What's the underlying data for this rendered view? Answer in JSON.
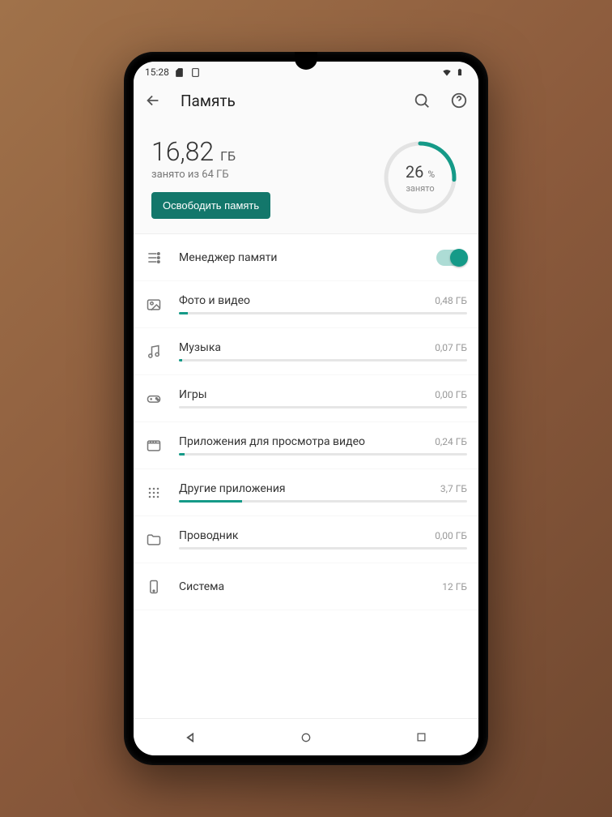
{
  "status": {
    "time": "15:28"
  },
  "header": {
    "title": "Память"
  },
  "summary": {
    "used_value": "16,82",
    "used_unit": "ГБ",
    "used_subtitle": "занято из 64 ГБ",
    "free_button": "Освободить память",
    "percent": "26",
    "percent_unit": "%",
    "percent_label": "занято"
  },
  "categories": [
    {
      "icon": "manager",
      "label": "Менеджер памяти",
      "value": "",
      "fill": 0,
      "toggle": true
    },
    {
      "icon": "photo",
      "label": "Фото и видео",
      "value": "0,48 ГБ",
      "fill": 3
    },
    {
      "icon": "music",
      "label": "Музыка",
      "value": "0,07 ГБ",
      "fill": 1
    },
    {
      "icon": "games",
      "label": "Игры",
      "value": "0,00 ГБ",
      "fill": 0
    },
    {
      "icon": "video",
      "label": "Приложения для просмотра видео",
      "value": "0,24 ГБ",
      "fill": 2
    },
    {
      "icon": "apps",
      "label": "Другие приложения",
      "value": "3,7 ГБ",
      "fill": 22
    },
    {
      "icon": "files",
      "label": "Проводник",
      "value": "0,00 ГБ",
      "fill": 0
    },
    {
      "icon": "system",
      "label": "Система",
      "value": "12 ГБ",
      "fill": 72,
      "nobar": true
    }
  ]
}
